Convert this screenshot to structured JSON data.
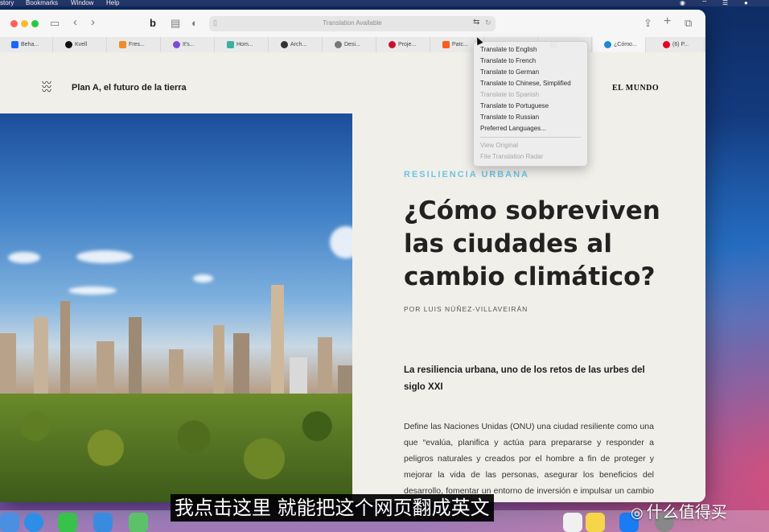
{
  "menubar": {
    "items": [
      "story",
      "Bookmarks",
      "Window",
      "Help"
    ]
  },
  "toolbar": {
    "address_text": "Translation Available",
    "icons": [
      "sidebar-icon",
      "back-icon",
      "forward-icon",
      "bookmark-icon",
      "reader-icon",
      "shield-icon",
      "share-icon",
      "new-tab-icon",
      "tab-overview-icon"
    ]
  },
  "tabs": [
    {
      "label": "Beha...",
      "color": "#1769ff",
      "active": false
    },
    {
      "label": "Kvell",
      "color": "#111111",
      "active": false
    },
    {
      "label": "Fres...",
      "color": "#f28c28",
      "active": false
    },
    {
      "label": "It's...",
      "color": "#7b4bd8",
      "active": false
    },
    {
      "label": "Hom...",
      "color": "#3bb0a0",
      "active": false
    },
    {
      "label": "Arch...",
      "color": "#333333",
      "active": false
    },
    {
      "label": "Desi...",
      "color": "#777777",
      "active": false
    },
    {
      "label": "Proje...",
      "color": "#c8102e",
      "active": false
    },
    {
      "label": "Patc...",
      "color": "#ff5a1f",
      "active": false
    },
    {
      "label": "",
      "color": "#5a9bd5",
      "active": false
    },
    {
      "label": "",
      "color": "#2a6fb5",
      "active": false
    },
    {
      "label": "¿Cómo...",
      "color": "#1a8ad8",
      "active": true
    },
    {
      "label": "(6) P...",
      "color": "#e60023",
      "active": false
    }
  ],
  "translate_menu": {
    "items": [
      {
        "label": "Translate to English",
        "disabled": false
      },
      {
        "label": "Translate to French",
        "disabled": false
      },
      {
        "label": "Translate to German",
        "disabled": false
      },
      {
        "label": "Translate to Chinese, Simplified",
        "disabled": false
      },
      {
        "label": "Translate to Spanish",
        "disabled": true
      },
      {
        "label": "Translate to Portuguese",
        "disabled": false
      },
      {
        "label": "Translate to Russian",
        "disabled": false
      },
      {
        "label": "Preferred Languages...",
        "disabled": false
      }
    ],
    "footer": [
      {
        "label": "View Original",
        "disabled": true
      },
      {
        "label": "File Translation Radar",
        "disabled": true
      }
    ]
  },
  "page": {
    "site_title": "Plan A, el futuro de la tierra",
    "brand": "EL MUNDO",
    "kicker": "RESILIENCIA URBANA",
    "headline": "¿Cómo sobreviven las ciudades al cambio climático?",
    "byline": "POR LUIS NÚÑEZ-VILLAVEIRÁN",
    "subhead": "La resiliencia urbana, uno de los retos de las urbes del siglo XXI",
    "body": "Define las Naciones Unidas (ONU) una ciudad resiliente como una que “evalúa, planifica y actúa para prepararse y responder a peligros naturales y creados por el hombre a fin de proteger y mejorar la vida de las personas, asegurar los beneficios del desarrollo, fomentar un entorno de inversión e impulsar un cambio positivo”. Estos desafíos, los tenemos a día de hoy muy"
  },
  "subtitle": "我点击这里 就能把这个网页翻成英文",
  "watermark": "什么值得买",
  "colors": {
    "kicker": "#6fc3e6",
    "close": "#ff5f57",
    "minimize": "#febc2e",
    "zoom": "#28c840"
  }
}
